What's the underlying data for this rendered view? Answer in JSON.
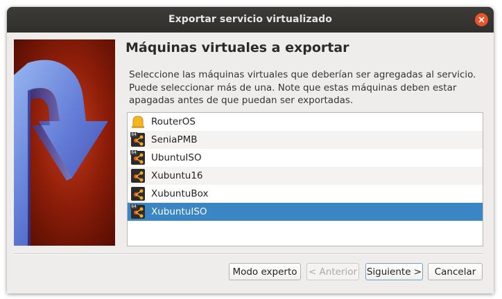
{
  "window": {
    "title": "Exportar servicio virtualizado"
  },
  "page": {
    "heading": "Máquinas virtuales a exportar",
    "description_lines": [
      "Seleccione las máquinas virtuales que deberían ser agregadas al servicio.",
      "Puede seleccionar más de una. Note que estas máquinas deben estar",
      "apagadas antes de que puedan ser exportadas."
    ]
  },
  "vm_list": {
    "items": [
      {
        "name": "RouterOS",
        "icon": "other-os-icon",
        "badge": "",
        "selected": false
      },
      {
        "name": "SeniaPMB",
        "icon": "ubuntu-icon",
        "badge": "64",
        "selected": false
      },
      {
        "name": "UbuntuISO",
        "icon": "ubuntu-icon",
        "badge": "64",
        "selected": false
      },
      {
        "name": "Xubuntu16",
        "icon": "ubuntu-icon",
        "badge": "",
        "selected": false
      },
      {
        "name": "XubuntuBox",
        "icon": "ubuntu-icon",
        "badge": "",
        "selected": false
      },
      {
        "name": "XubuntuISO",
        "icon": "ubuntu-icon",
        "badge": "64",
        "selected": true
      }
    ]
  },
  "buttons": {
    "expert": "Modo experto",
    "back": "< Anterior",
    "next": "Siguiente >",
    "cancel": "Cancelar"
  },
  "colors": {
    "selection": "#3a85c4",
    "close": "#e9542b",
    "titlebar": "#302f2c"
  }
}
